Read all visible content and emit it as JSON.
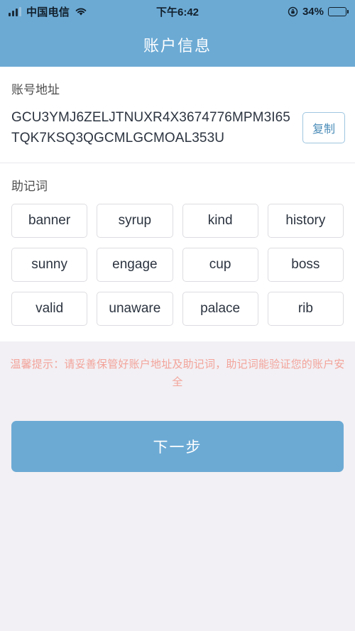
{
  "status_bar": {
    "carrier": "中国电信",
    "signal_icon": "signal-bars-icon",
    "wifi_icon": "wifi-icon",
    "time": "下午6:42",
    "rotation_lock_icon": "rotation-lock-icon",
    "battery_percent": "34%",
    "battery_level": 34,
    "battery_icon": "battery-icon"
  },
  "header": {
    "title": "账户信息"
  },
  "account": {
    "label": "账号地址",
    "address": "GCU3YMJ6ZELJTNUXR4X3674776MPM3I65TQK7KSQ3QGCMLGCMOAL353U",
    "copy_label": "复制"
  },
  "mnemonic": {
    "label": "助记词",
    "words": [
      "banner",
      "syrup",
      "kind",
      "history",
      "sunny",
      "engage",
      "cup",
      "boss",
      "valid",
      "unaware",
      "palace",
      "rib"
    ]
  },
  "warning": {
    "text": "温馨提示：请妥善保管好账户地址及助记词，助记词能验证您的账户安全"
  },
  "footer": {
    "next_label": "下一步"
  },
  "colors": {
    "brand_blue": "#6caad4",
    "page_bg": "#f2f0f4",
    "card_bg": "#ffffff",
    "warning_red": "#f3a39a",
    "chip_border": "#dddde2",
    "copy_border": "#9fc6e0",
    "copy_text": "#4a8cb8"
  }
}
